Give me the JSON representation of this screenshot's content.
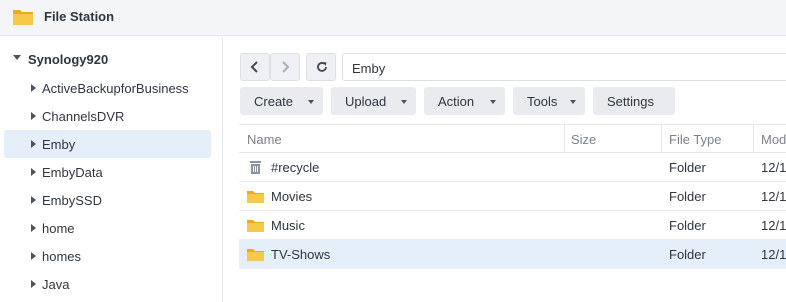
{
  "app": {
    "title": "File Station"
  },
  "sidebar": {
    "root": "Synology920",
    "items": [
      {
        "label": "ActiveBackupforBusiness",
        "selected": false
      },
      {
        "label": "ChannelsDVR",
        "selected": false
      },
      {
        "label": "Emby",
        "selected": true
      },
      {
        "label": "EmbyData",
        "selected": false
      },
      {
        "label": "EmbySSD",
        "selected": false
      },
      {
        "label": "home",
        "selected": false
      },
      {
        "label": "homes",
        "selected": false
      },
      {
        "label": "Java",
        "selected": false
      }
    ]
  },
  "path": {
    "value": "Emby"
  },
  "toolbar": {
    "create": "Create",
    "upload": "Upload",
    "action": "Action",
    "tools": "Tools",
    "settings": "Settings"
  },
  "grid": {
    "columns": {
      "name": "Name",
      "size": "Size",
      "type": "File Type",
      "modified": "Mod"
    },
    "rows": [
      {
        "name": "#recycle",
        "type": "Folder",
        "modified": "12/1",
        "icon": "recycle-bin-icon",
        "selected": false
      },
      {
        "name": "Movies",
        "type": "Folder",
        "modified": "12/1",
        "icon": "folder-icon",
        "selected": false
      },
      {
        "name": "Music",
        "type": "Folder",
        "modified": "12/1",
        "icon": "folder-icon",
        "selected": false
      },
      {
        "name": "TV-Shows",
        "type": "Folder",
        "modified": "12/1",
        "icon": "folder-icon",
        "selected": true
      }
    ]
  },
  "colors": {
    "accent": "#e5effa",
    "folder": "#f6c341",
    "toolbar_button": "#e9ebee"
  }
}
